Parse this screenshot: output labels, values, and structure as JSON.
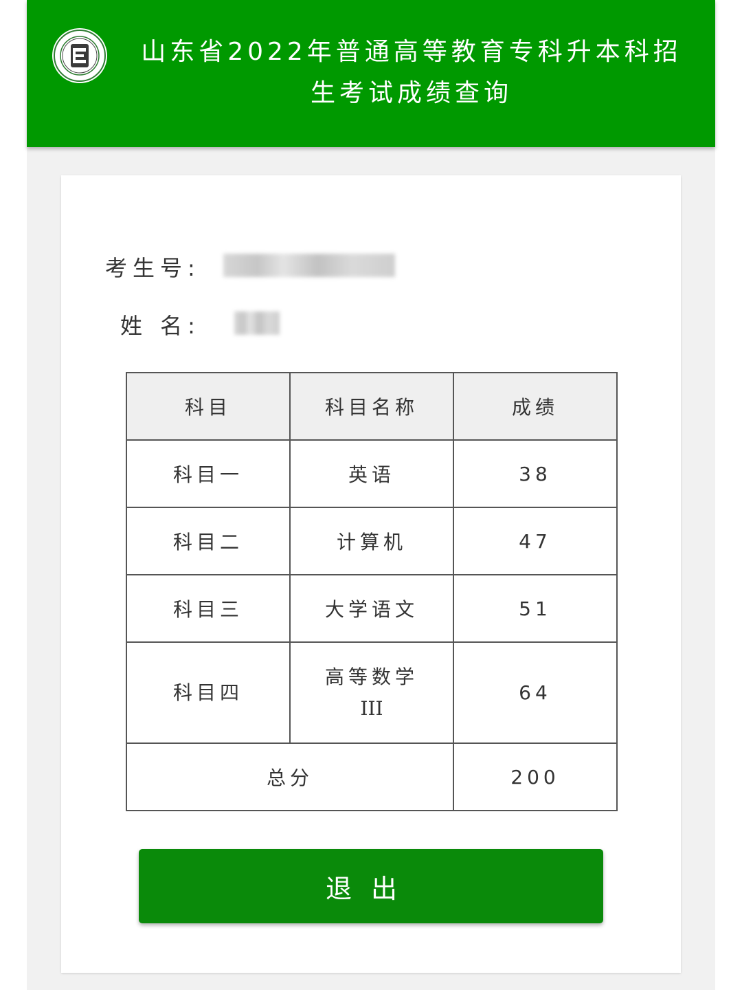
{
  "header": {
    "title_line1": "山东省2022年普通高等教育专科升本科招",
    "title_line2": "生考试成绩查询",
    "logo_icon": "exam-institute-logo-icon",
    "background_color": "#009900"
  },
  "candidate": {
    "id_label": "考生号:",
    "name_label": "姓  名:"
  },
  "table": {
    "headers": [
      "科目",
      "科目名称",
      "成绩"
    ],
    "rows": [
      {
        "subject": "科目一",
        "name": "英语",
        "score": "38"
      },
      {
        "subject": "科目二",
        "name": "计算机",
        "score": "47"
      },
      {
        "subject": "科目三",
        "name": "大学语文",
        "score": "51"
      },
      {
        "subject": "科目四",
        "name": "高等数学",
        "name_suffix": "III",
        "score": "64"
      }
    ],
    "total_label": "总分",
    "total_score": "200"
  },
  "logout": {
    "label": "退出",
    "color": "#0a8a0a"
  }
}
